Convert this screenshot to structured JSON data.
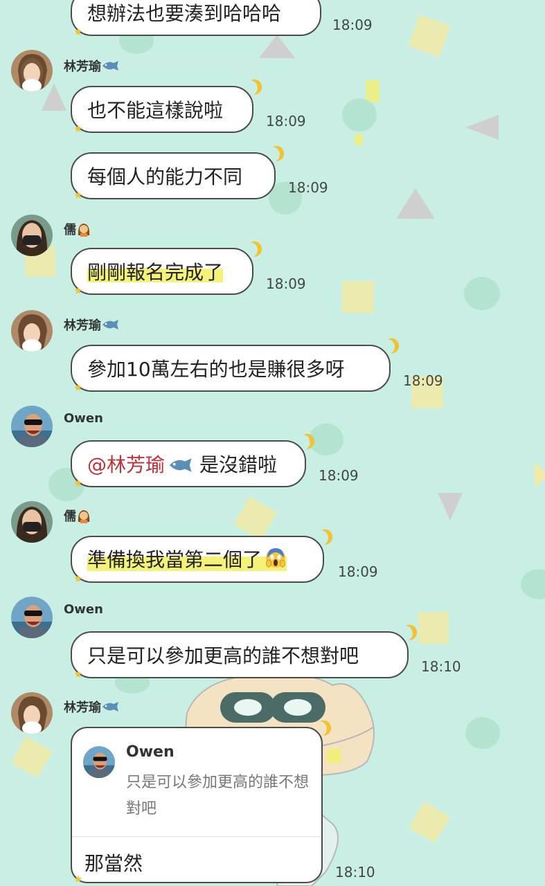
{
  "colors": {
    "background": "#c9efe4",
    "bubble_border": "#4a4a4a",
    "highlight": "#f5f27a",
    "mention": "#c0303a",
    "accent_yellow": "#f2c230"
  },
  "messages": [
    {
      "text": "想辦法也要湊到哈哈哈",
      "time": "18:09"
    },
    {
      "sender": "林芳瑜",
      "sender_icon": "fish-icon",
      "text": "也不能這樣說啦",
      "time": "18:09"
    },
    {
      "text": "每個人的能力不同",
      "time": "18:09"
    },
    {
      "sender": "儒",
      "sender_icon": "woman-icon",
      "text": "剛剛報名完成了",
      "time": "18:09"
    },
    {
      "sender": "林芳瑜",
      "sender_icon": "fish-icon",
      "text": "參加10萬左右的也是賺很多呀",
      "time": "18:09"
    },
    {
      "sender": "Owen",
      "mention": "@林芳瑜",
      "mention_icon": "fish-icon",
      "text": "是沒錯啦",
      "time": "18:09"
    },
    {
      "sender": "儒",
      "sender_icon": "woman-icon",
      "text": "準備換我當第二個了",
      "text_icon": "scream-emoji-icon",
      "time": "18:09"
    },
    {
      "sender": "Owen",
      "text": "只是可以參加更高的誰不想對吧",
      "time": "18:10"
    },
    {
      "sender": "林芳瑜",
      "sender_icon": "fish-icon",
      "quote": {
        "name": "Owen",
        "text": "只是可以參加更高的誰不想對吧"
      },
      "text": "那當然",
      "time": "18:10"
    }
  ]
}
